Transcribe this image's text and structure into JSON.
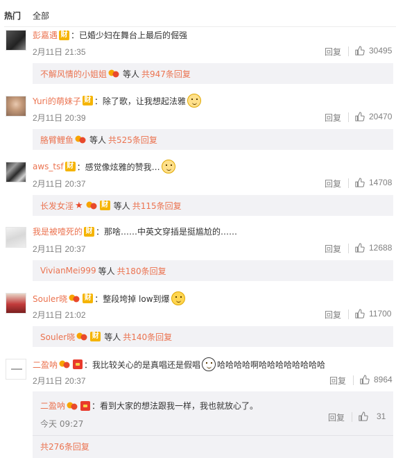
{
  "tabs": [
    {
      "label": "热门",
      "active": true
    },
    {
      "label": "全部",
      "active": false
    }
  ],
  "reply_label": "回复",
  "thumb_icon": "thumbs-up-icon",
  "comments": [
    {
      "user": "彭嘉遇",
      "text": "：已婚少妇在舞台上最后的倔强",
      "time": "2月11日 21:35",
      "likes": "30495",
      "sub": {
        "users": "不解风情的小姐姐",
        "etc": "等人",
        "count": "共947条回复"
      }
    },
    {
      "user": "Yuri的萌妹子",
      "text": "：除了歌，让我想起法雅",
      "time": "2月11日 20:39",
      "likes": "20470",
      "sub": {
        "users": "胳臂鲤鱼",
        "etc": "等人",
        "count": "共525条回复"
      }
    },
    {
      "user": "aws_tsf",
      "text": "：感觉像炫雅的赞我…",
      "time": "2月11日 20:37",
      "likes": "14708",
      "sub": {
        "users": "长发女淫",
        "etc": "等人",
        "count": "共115条回复"
      }
    },
    {
      "user": "我是被噎死的",
      "text": "：那啥……中英文穿插是挺尴尬的……",
      "time": "2月11日 20:37",
      "likes": "12688",
      "sub": {
        "users": "VivianMei999",
        "etc": "等人",
        "count": "共180条回复"
      }
    },
    {
      "user": "Souler晓",
      "text": "：整段垮掉   low到爆",
      "time": "2月11日 21:02",
      "likes": "11700",
      "sub": {
        "users": "Souler晓",
        "etc": "等人",
        "count": "共140条回复"
      }
    },
    {
      "user": "二盈呐",
      "text": "：我比较关心的是真唱还是假唱",
      "text2": "哈哈哈哈啊哈哈哈哈哈哈哈哈",
      "time": "2月11日 20:37",
      "likes": "8964",
      "nested": {
        "user": "二盈呐",
        "text": "：看到大家的想法跟我一样，我也就放心了。",
        "time": "今天 09:27",
        "likes": "31",
        "more": "共276条回复"
      }
    }
  ],
  "badges": {
    "cai": "财"
  },
  "colors": {
    "accent": "#eb7350",
    "meta": "#808080",
    "subbox_bg": "#f2f2f5",
    "badge_gold": "#f5b400"
  }
}
